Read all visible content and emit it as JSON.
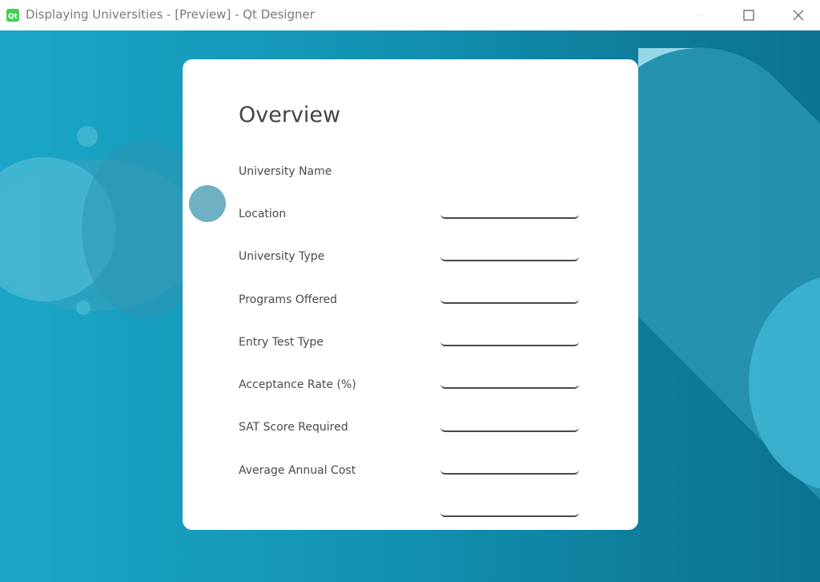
{
  "window": {
    "title": "Displaying Universities - [Preview] - Qt Designer",
    "app_icon": "qt-icon",
    "controls": [
      "minimize-icon",
      "maximize-icon",
      "close-icon"
    ]
  },
  "colors": {
    "background_start": "#1ba6c8",
    "background_end": "#0c7391",
    "card": "#ffffff",
    "accent_shape_light": "#9ddcec",
    "accent_shape_mid": "#3fb6d4",
    "label": "#4a4a4a",
    "heading": "#444444"
  },
  "card": {
    "heading": "Overview",
    "fields": [
      {
        "label": "University Name",
        "value": ""
      },
      {
        "label": "Location",
        "value": ""
      },
      {
        "label": "University Type",
        "value": ""
      },
      {
        "label": "Programs Offered",
        "value": ""
      },
      {
        "label": "Entry Test Type",
        "value": ""
      },
      {
        "label": "Acceptance Rate (%)",
        "value": ""
      },
      {
        "label": "SAT Score Required",
        "value": ""
      },
      {
        "label": "Average Annual Cost",
        "value": ""
      }
    ]
  }
}
